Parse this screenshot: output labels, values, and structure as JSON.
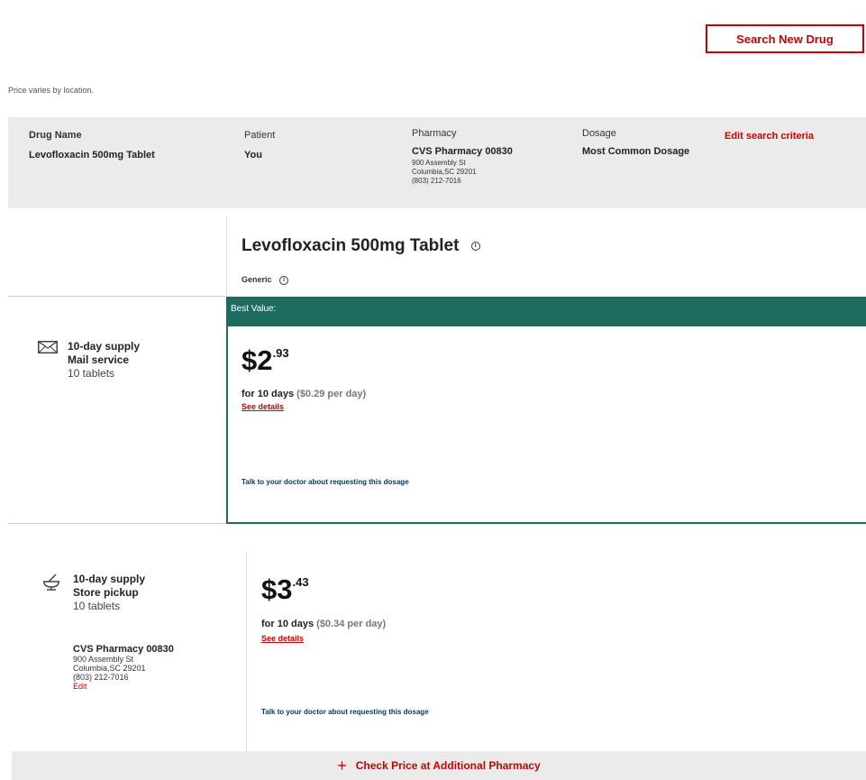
{
  "header": {
    "search_button": "Search New Drug",
    "price_note": "Price varies by location."
  },
  "criteria": {
    "drug_name_label": "Drug Name",
    "drug_name": "Levofloxacin 500mg Tablet",
    "patient_label": "Patient",
    "patient": "You",
    "pharmacy_label": "Pharmacy",
    "pharmacy_name": "CVS Pharmacy 00830",
    "pharmacy_address1": "900 Assembly St",
    "pharmacy_address2": "Columbia,SC 29201",
    "pharmacy_phone": "(803) 212-7016",
    "dosage_label": "Dosage",
    "dosage": "Most Common Dosage",
    "edit_link": "Edit search criteria"
  },
  "drug": {
    "title": "Levofloxacin 500mg Tablet",
    "type": "Generic",
    "info_glyph": "i"
  },
  "best_value": {
    "banner": "Best Value:",
    "supply": "10-day supply",
    "method": "Mail service",
    "quantity": "10 tablets",
    "price_dollars": "$2",
    "price_cents": ".93",
    "duration": "for 10 days",
    "per_day": "($0.29 per day)",
    "details": "See details",
    "note": "Talk to your doctor about requesting this dosage"
  },
  "store_option": {
    "supply": "10-day supply",
    "method": "Store pickup",
    "quantity": "10 tablets",
    "pharmacy_name": "CVS Pharmacy 00830",
    "pharmacy_address1": "900 Assembly St",
    "pharmacy_address2": "Columbia,SC 29201",
    "pharmacy_phone": "(803) 212-7016",
    "edit": "Edit",
    "price_dollars": "$3",
    "price_cents": ".43",
    "duration": "for 10 days",
    "per_day": "($0.34 per day)",
    "details": "See details",
    "note": "Talk to your doctor about requesting this dosage"
  },
  "footer": {
    "plus": "+",
    "check_price": "Check Price at Additional Pharmacy"
  },
  "colors": {
    "accent_red": "#cc0000",
    "best_value_green": "#1e6b62",
    "panel_gray": "#ebebeb"
  },
  "icons": [
    "envelope-icon",
    "mortar-pestle-icon",
    "info-icon"
  ]
}
